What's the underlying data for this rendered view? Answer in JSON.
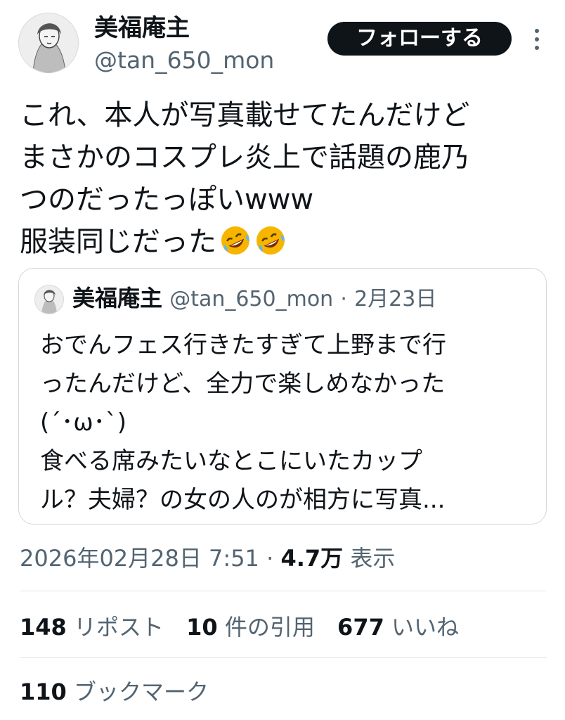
{
  "author": {
    "name": "美福庵主",
    "handle": "@tan_650_mon"
  },
  "follow_button": {
    "label": "フォローする"
  },
  "more_icon": "more-vertical-icon",
  "tweet": {
    "text": "これ、本人が写真載せてたんだけど\nまさかのコスプレ炎上で話題の鹿乃\nつのだったっぽいwww\n服装同じだった",
    "emojis": [
      "rolling-on-floor-laughing-icon",
      "rolling-on-floor-laughing-icon"
    ]
  },
  "quote": {
    "name": "美福庵主",
    "handle": "@tan_650_mon",
    "separator": "·",
    "date": "2月23日",
    "text": "おでんフェス行きたすぎて上野まで行\nったんだけど、全力で楽しめなかった\n(´･ω･`)\n食べる席みたいなとこにいたカップ\nル？夫婦？の女の人のが相方に写真..."
  },
  "meta": {
    "timestamp": "2026年02月28日 7:51",
    "separator": "·",
    "views_count": "4.7万",
    "views_label": "表示"
  },
  "stats": {
    "reposts_count": "148",
    "reposts_label": "リポスト",
    "quotes_count": "10",
    "quotes_label": "件の引用",
    "likes_count": "677",
    "likes_label": "いいね",
    "bookmarks_count": "110",
    "bookmarks_label": "ブックマーク"
  },
  "colors": {
    "text_primary": "#0f1419",
    "text_secondary": "#536471",
    "border": "#cfd9de",
    "button_bg": "#0f1419",
    "emoji_yellow": "#f7b500"
  }
}
